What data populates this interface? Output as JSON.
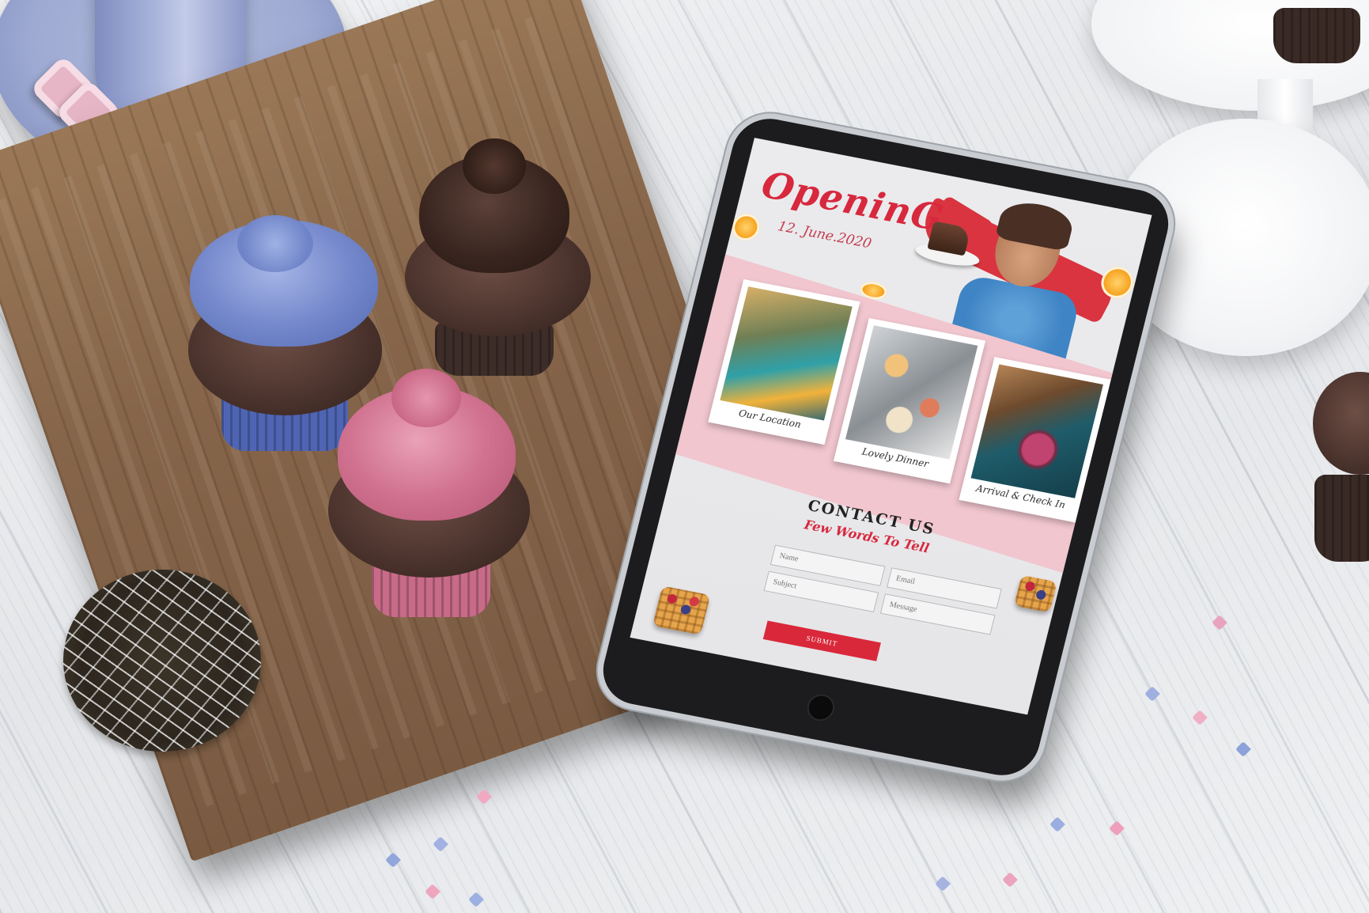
{
  "hero": {
    "title": "OpeninG",
    "date": "12. June.2020"
  },
  "gallery": [
    {
      "caption": "Our Location"
    },
    {
      "caption": "Lovely Dinner"
    },
    {
      "caption": "Arrival & Check In"
    }
  ],
  "contact": {
    "heading": "CONTACT US",
    "subheading": "Few Words To Tell",
    "fields": {
      "name_placeholder": "Name",
      "email_placeholder": "Email",
      "subject_placeholder": "Subject",
      "message_placeholder": "Message"
    },
    "submit_label": "SUBMIT"
  },
  "colors": {
    "accent_red": "#d7283e",
    "band_pink": "#f1c6cf",
    "frosting_blue": "#6f86c9",
    "frosting_pink": "#cf6f8d",
    "frosting_chocolate": "#3a2620"
  }
}
